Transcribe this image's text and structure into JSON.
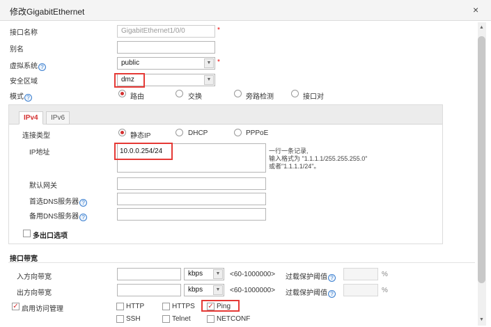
{
  "dialog": {
    "title": "修改GigabitEthernet",
    "close_glyph": "×"
  },
  "form": {
    "interface_name": {
      "label": "接口名称",
      "value": "GigabitEthernet1/0/0",
      "required": "*"
    },
    "alias": {
      "label": "别名",
      "value": ""
    },
    "vsys": {
      "label": "虚拟系统",
      "value": "public",
      "required": "*"
    },
    "zone": {
      "label": "安全区域",
      "value": "dmz"
    },
    "mode": {
      "label": "模式",
      "options": [
        "路由",
        "交换",
        "旁路检测",
        "接口对"
      ],
      "selected": "路由"
    }
  },
  "tabs": [
    {
      "label": "IPv4",
      "active": true
    },
    {
      "label": "IPv6",
      "active": false
    }
  ],
  "ipv4": {
    "conn_type": {
      "label": "连接类型",
      "options": [
        "静态IP",
        "DHCP",
        "PPPoE"
      ],
      "selected": "静态IP"
    },
    "ip": {
      "label": "IP地址",
      "value": "10.0.0.254/24",
      "hint_line1": "一行一条记录,",
      "hint_line2": "输入格式为 \"1.1.1.1/255.255.255.0\"",
      "hint_line3": "或者\"1.1.1.1/24\"。"
    },
    "gateway": {
      "label": "默认网关",
      "value": ""
    },
    "dns_primary": {
      "label": "首选DNS服务器",
      "value": ""
    },
    "dns_secondary": {
      "label": "备用DNS服务器",
      "value": ""
    },
    "multi_egress": {
      "label": "多出口选项",
      "checked": false
    }
  },
  "bandwidth": {
    "section_title": "接口带宽",
    "inbound": {
      "label": "入方向带宽",
      "value": "",
      "unit": "kbps",
      "range": "<60-1000000>",
      "overload_label": "过载保护阈值",
      "overload_value": "",
      "pct": "%"
    },
    "outbound": {
      "label": "出方向带宽",
      "value": "",
      "unit": "kbps",
      "range": "<60-1000000>",
      "overload_label": "过载保护阈值",
      "overload_value": "",
      "pct": "%"
    }
  },
  "access_mgmt": {
    "label": "启用访问管理",
    "checked": true,
    "services": [
      {
        "label": "HTTP",
        "checked": false
      },
      {
        "label": "HTTPS",
        "checked": false
      },
      {
        "label": "Ping",
        "checked": true
      },
      {
        "label": "SSH",
        "checked": false
      },
      {
        "label": "Telnet",
        "checked": false
      },
      {
        "label": "NETCONF",
        "checked": false
      }
    ]
  },
  "icons": {
    "help": "?",
    "dropdown": "▼",
    "check": "✓",
    "scroll_up": "▲",
    "scroll_down": "▼"
  },
  "colors": {
    "highlight": "#e53935",
    "accent_red": "#d32f2f",
    "help_blue": "#3a7fd0"
  }
}
